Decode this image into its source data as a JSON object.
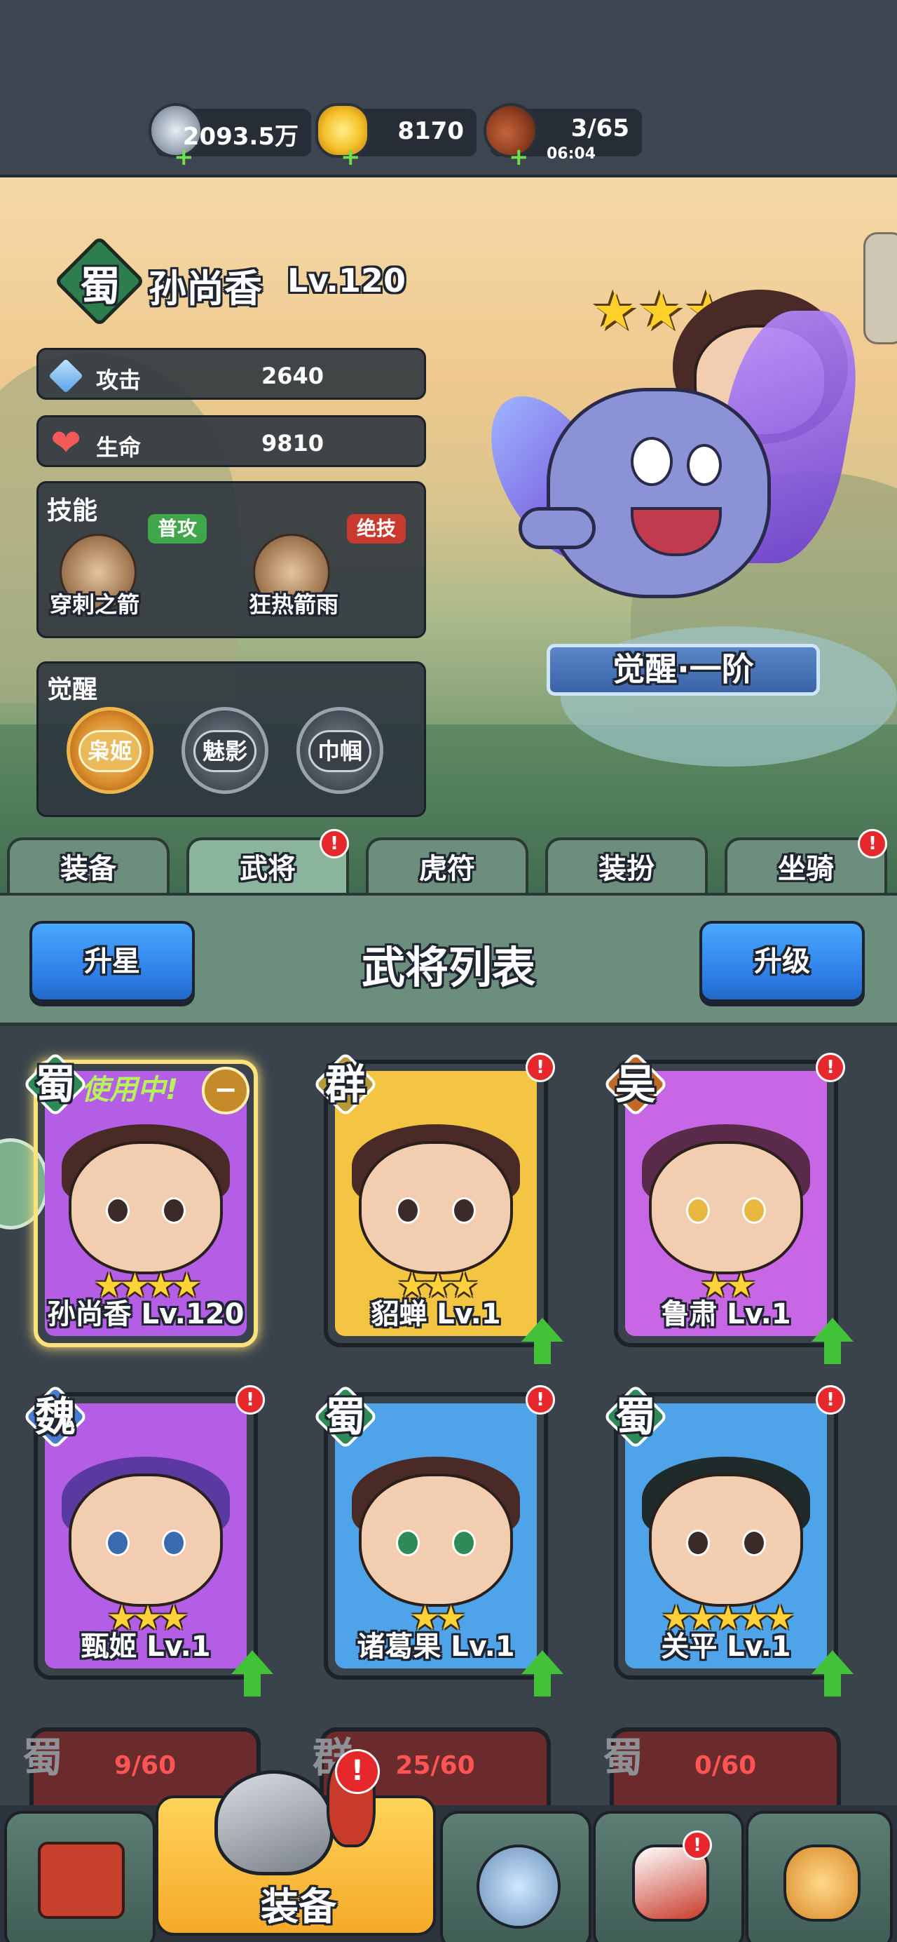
{
  "resources": [
    {
      "name": "silver",
      "value": "2093.5万"
    },
    {
      "name": "gold",
      "value": "8170"
    },
    {
      "name": "stamina",
      "value": "3/65",
      "timer": "06:04"
    }
  ],
  "hero": {
    "kingdom": "蜀",
    "name": "孙尚香",
    "level": "Lv.120",
    "stars": 3,
    "stats": [
      {
        "icon": "sword-icon",
        "label": "攻击",
        "value": "2640"
      },
      {
        "icon": "heart-icon",
        "label": "生命",
        "value": "9810"
      }
    ],
    "skills_title": "技能",
    "skills": [
      {
        "tag": "普攻",
        "name": "穿刺之箭",
        "tag_color": "#3fa64a"
      },
      {
        "tag": "绝技",
        "name": "狂热箭雨",
        "tag_color": "#c93a2e"
      }
    ],
    "awaken_title": "觉醒",
    "awaken_items": [
      "枭姬",
      "魅影",
      "巾帼"
    ],
    "awaken_stage": "觉醒·一阶"
  },
  "tabs": [
    {
      "label": "装备",
      "badge": false
    },
    {
      "label": "武将",
      "badge": true
    },
    {
      "label": "虎符",
      "badge": false
    },
    {
      "label": "装扮",
      "badge": false
    },
    {
      "label": "坐骑",
      "badge": true
    }
  ],
  "list_header": {
    "left_button": "升星",
    "title": "武将列表",
    "right_button": "升级"
  },
  "in_use_label": "使用中!",
  "heroes": [
    {
      "kingdom": "蜀",
      "name": "孙尚香 Lv.120",
      "stars": "★★★★",
      "color": "#b45ee6",
      "in_use": true,
      "badge": false,
      "upgrade": false,
      "kcolor": "#2e8b57"
    },
    {
      "kingdom": "群",
      "name": "貂蝉 Lv.1",
      "stars": "★★★",
      "color": "#f4c542",
      "in_use": false,
      "badge": true,
      "upgrade": true,
      "kcolor": "#b69a3a"
    },
    {
      "kingdom": "吴",
      "name": "鲁肃 Lv.1",
      "stars": "★★",
      "color": "#c867e6",
      "in_use": false,
      "badge": true,
      "upgrade": true,
      "kcolor": "#c06a2a"
    },
    {
      "kingdom": "魏",
      "name": "甄姬 Lv.1",
      "stars": "★★★",
      "color": "#b45ee6",
      "in_use": false,
      "badge": true,
      "upgrade": true,
      "kcolor": "#4a7bd0"
    },
    {
      "kingdom": "蜀",
      "name": "诸葛果 Lv.1",
      "stars": "★★",
      "color": "#4fa3e8",
      "in_use": false,
      "badge": true,
      "upgrade": true,
      "kcolor": "#2e8b57"
    },
    {
      "kingdom": "蜀",
      "name": "关平 Lv.1",
      "stars": "★★★★★",
      "color": "#4fa3e8",
      "in_use": false,
      "badge": true,
      "upgrade": true,
      "kcolor": "#2e8b57"
    }
  ],
  "locked_heroes": [
    {
      "kingdom": "蜀",
      "progress": "9/60"
    },
    {
      "kingdom": "群",
      "progress": "25/60"
    },
    {
      "kingdom": "蜀",
      "progress": "0/60"
    }
  ],
  "bottom_nav": {
    "selected_label": "装备",
    "badge": "!"
  }
}
